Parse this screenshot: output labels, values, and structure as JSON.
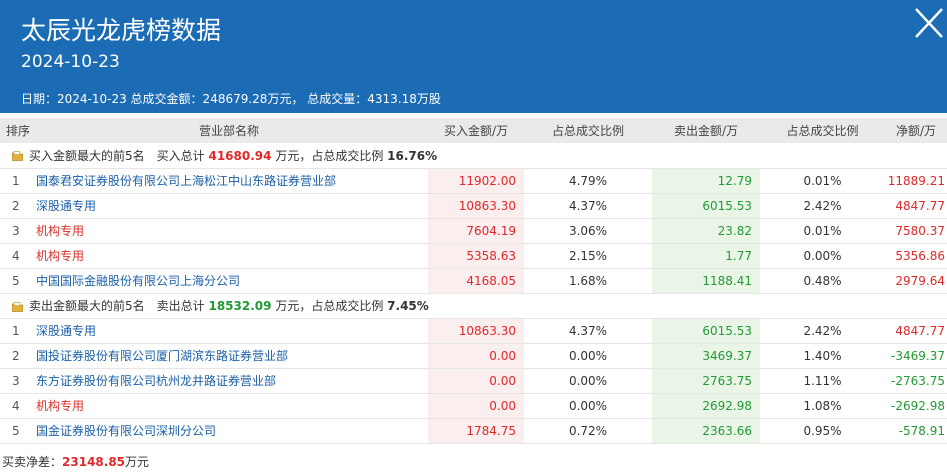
{
  "header": {
    "title": "太辰光龙虎榜数据",
    "date": "2024-10-23",
    "summary": "日期：2024-10-23 总成交金额：248679.28万元， 总成交量：4313.18万股"
  },
  "columns": [
    "排序",
    "营业部名称",
    "买入金额/万",
    "占总成交比例",
    "卖出金额/万",
    "占总成交比例",
    "净额/万"
  ],
  "buy_section": {
    "label": "买入金额最大的前5名",
    "total_prefix": "买入总计",
    "total_value": "41680.94",
    "total_suffix": "万元，占总成交比例",
    "ratio": "16.76%",
    "rows": [
      {
        "rank": "1",
        "name": "国泰君安证券股份有限公司上海松江中山东路证券营业部",
        "institution": false,
        "buy": "11902.00",
        "buy_pct": "4.79%",
        "sell": "12.79",
        "sell_pct": "0.01%",
        "net": "11889.21",
        "net_sign": "pos"
      },
      {
        "rank": "2",
        "name": "深股通专用",
        "institution": false,
        "buy": "10863.30",
        "buy_pct": "4.37%",
        "sell": "6015.53",
        "sell_pct": "2.42%",
        "net": "4847.77",
        "net_sign": "pos"
      },
      {
        "rank": "3",
        "name": "机构专用",
        "institution": true,
        "buy": "7604.19",
        "buy_pct": "3.06%",
        "sell": "23.82",
        "sell_pct": "0.01%",
        "net": "7580.37",
        "net_sign": "pos"
      },
      {
        "rank": "4",
        "name": "机构专用",
        "institution": true,
        "buy": "5358.63",
        "buy_pct": "2.15%",
        "sell": "1.77",
        "sell_pct": "0.00%",
        "net": "5356.86",
        "net_sign": "pos"
      },
      {
        "rank": "5",
        "name": "中国国际金融股份有限公司上海分公司",
        "institution": false,
        "buy": "4168.05",
        "buy_pct": "1.68%",
        "sell": "1188.41",
        "sell_pct": "0.48%",
        "net": "2979.64",
        "net_sign": "pos"
      }
    ]
  },
  "sell_section": {
    "label": "卖出金额最大的前5名",
    "total_prefix": "卖出总计",
    "total_value": "18532.09",
    "total_suffix": "万元，占总成交比例",
    "ratio": "7.45%",
    "rows": [
      {
        "rank": "1",
        "name": "深股通专用",
        "institution": false,
        "buy": "10863.30",
        "buy_pct": "4.37%",
        "sell": "6015.53",
        "sell_pct": "2.42%",
        "net": "4847.77",
        "net_sign": "pos"
      },
      {
        "rank": "2",
        "name": "国投证券股份有限公司厦门湖滨东路证券营业部",
        "institution": false,
        "buy": "0.00",
        "buy_pct": "0.00%",
        "sell": "3469.37",
        "sell_pct": "1.40%",
        "net": "-3469.37",
        "net_sign": "neg"
      },
      {
        "rank": "3",
        "name": "东方证券股份有限公司杭州龙井路证券营业部",
        "institution": false,
        "buy": "0.00",
        "buy_pct": "0.00%",
        "sell": "2763.75",
        "sell_pct": "1.11%",
        "net": "-2763.75",
        "net_sign": "neg"
      },
      {
        "rank": "4",
        "name": "机构专用",
        "institution": true,
        "buy": "0.00",
        "buy_pct": "0.00%",
        "sell": "2692.98",
        "sell_pct": "1.08%",
        "net": "-2692.98",
        "net_sign": "neg"
      },
      {
        "rank": "5",
        "name": "国金证券股份有限公司深圳分公司",
        "institution": false,
        "buy": "1784.75",
        "buy_pct": "0.72%",
        "sell": "2363.66",
        "sell_pct": "0.95%",
        "net": "-578.91",
        "net_sign": "neg"
      }
    ]
  },
  "footer": {
    "label": "买卖净差：",
    "value": "23148.85",
    "unit": "万元"
  },
  "colors": {
    "header_bg": "#1c6cb5",
    "buy_red": "#e0282a",
    "sell_green": "#229a33",
    "link_blue": "#1a5fa7",
    "institution_red": "#d9302a"
  },
  "icons": {
    "close": "close-icon",
    "section": "folder-icon"
  }
}
